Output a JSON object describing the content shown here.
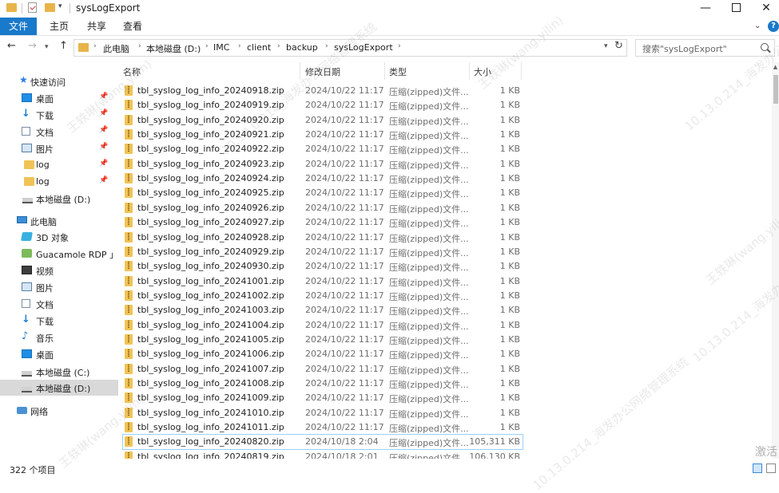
{
  "window": {
    "title": "sysLogExport",
    "min_glyph": "—",
    "close_glyph": "✕"
  },
  "ribbon": {
    "tabs": [
      {
        "label": "文件"
      },
      {
        "label": "主页"
      },
      {
        "label": "共享"
      },
      {
        "label": "查看"
      }
    ],
    "collapse_glyph": "⌄",
    "help_glyph": "?"
  },
  "address": {
    "crumbs": [
      "此电脑",
      "本地磁盘 (D:)",
      "IMC",
      "client",
      "backup",
      "sysLogExport"
    ],
    "separator": "›"
  },
  "search": {
    "placeholder": "搜索\"sysLogExport\""
  },
  "sidebar": {
    "items": [
      {
        "label": "快速访问",
        "icon": "star-icon",
        "pinned": false
      },
      {
        "label": "桌面",
        "icon": "desktop-icon",
        "pinned": true
      },
      {
        "label": "下载",
        "icon": "download-icon",
        "pinned": true
      },
      {
        "label": "文档",
        "icon": "document-icon",
        "pinned": true
      },
      {
        "label": "图片",
        "icon": "pictures-icon",
        "pinned": true
      },
      {
        "label": "log",
        "icon": "folder-icon",
        "pinned": true
      },
      {
        "label": "log",
        "icon": "folder-icon",
        "pinned": true
      },
      {
        "label": "本地磁盘 (D:)",
        "icon": "drive-icon",
        "pinned": false
      },
      {
        "label": "此电脑",
        "icon": "pc-icon",
        "pinned": false
      },
      {
        "label": "3D 对象",
        "icon": "3d-objects-icon",
        "pinned": false
      },
      {
        "label": "Guacamole RDP 」",
        "icon": "rdp-icon",
        "pinned": false
      },
      {
        "label": "视频",
        "icon": "video-icon",
        "pinned": false
      },
      {
        "label": "图片",
        "icon": "pictures-icon",
        "pinned": false
      },
      {
        "label": "文档",
        "icon": "document-icon",
        "pinned": false
      },
      {
        "label": "下载",
        "icon": "download-icon",
        "pinned": false
      },
      {
        "label": "音乐",
        "icon": "music-icon",
        "pinned": false
      },
      {
        "label": "桌面",
        "icon": "desktop-icon",
        "pinned": false
      },
      {
        "label": "本地磁盘 (C:)",
        "icon": "drive-icon",
        "pinned": false
      },
      {
        "label": "本地磁盘 (D:)",
        "icon": "drive-icon",
        "pinned": false,
        "selected": true
      },
      {
        "label": "网络",
        "icon": "network-icon",
        "pinned": false
      }
    ],
    "pin_glyph": "📌"
  },
  "columns": {
    "name": "名称",
    "date": "修改日期",
    "type": "类型",
    "size": "大小"
  },
  "files": [
    {
      "name": "tbl_syslog_log_info_20240918.zip",
      "date": "2024/10/22 11:17",
      "type": "压缩(zipped)文件...",
      "size": "1 KB"
    },
    {
      "name": "tbl_syslog_log_info_20240919.zip",
      "date": "2024/10/22 11:17",
      "type": "压缩(zipped)文件...",
      "size": "1 KB"
    },
    {
      "name": "tbl_syslog_log_info_20240920.zip",
      "date": "2024/10/22 11:17",
      "type": "压缩(zipped)文件...",
      "size": "1 KB"
    },
    {
      "name": "tbl_syslog_log_info_20240921.zip",
      "date": "2024/10/22 11:17",
      "type": "压缩(zipped)文件...",
      "size": "1 KB"
    },
    {
      "name": "tbl_syslog_log_info_20240922.zip",
      "date": "2024/10/22 11:17",
      "type": "压缩(zipped)文件...",
      "size": "1 KB"
    },
    {
      "name": "tbl_syslog_log_info_20240923.zip",
      "date": "2024/10/22 11:17",
      "type": "压缩(zipped)文件...",
      "size": "1 KB"
    },
    {
      "name": "tbl_syslog_log_info_20240924.zip",
      "date": "2024/10/22 11:17",
      "type": "压缩(zipped)文件...",
      "size": "1 KB"
    },
    {
      "name": "tbl_syslog_log_info_20240925.zip",
      "date": "2024/10/22 11:17",
      "type": "压缩(zipped)文件...",
      "size": "1 KB"
    },
    {
      "name": "tbl_syslog_log_info_20240926.zip",
      "date": "2024/10/22 11:17",
      "type": "压缩(zipped)文件...",
      "size": "1 KB"
    },
    {
      "name": "tbl_syslog_log_info_20240927.zip",
      "date": "2024/10/22 11:17",
      "type": "压缩(zipped)文件...",
      "size": "1 KB"
    },
    {
      "name": "tbl_syslog_log_info_20240928.zip",
      "date": "2024/10/22 11:17",
      "type": "压缩(zipped)文件...",
      "size": "1 KB"
    },
    {
      "name": "tbl_syslog_log_info_20240929.zip",
      "date": "2024/10/22 11:17",
      "type": "压缩(zipped)文件...",
      "size": "1 KB"
    },
    {
      "name": "tbl_syslog_log_info_20240930.zip",
      "date": "2024/10/22 11:17",
      "type": "压缩(zipped)文件...",
      "size": "1 KB"
    },
    {
      "name": "tbl_syslog_log_info_20241001.zip",
      "date": "2024/10/22 11:17",
      "type": "压缩(zipped)文件...",
      "size": "1 KB"
    },
    {
      "name": "tbl_syslog_log_info_20241002.zip",
      "date": "2024/10/22 11:17",
      "type": "压缩(zipped)文件...",
      "size": "1 KB"
    },
    {
      "name": "tbl_syslog_log_info_20241003.zip",
      "date": "2024/10/22 11:17",
      "type": "压缩(zipped)文件...",
      "size": "1 KB"
    },
    {
      "name": "tbl_syslog_log_info_20241004.zip",
      "date": "2024/10/22 11:17",
      "type": "压缩(zipped)文件...",
      "size": "1 KB"
    },
    {
      "name": "tbl_syslog_log_info_20241005.zip",
      "date": "2024/10/22 11:17",
      "type": "压缩(zipped)文件...",
      "size": "1 KB"
    },
    {
      "name": "tbl_syslog_log_info_20241006.zip",
      "date": "2024/10/22 11:17",
      "type": "压缩(zipped)文件...",
      "size": "1 KB"
    },
    {
      "name": "tbl_syslog_log_info_20241007.zip",
      "date": "2024/10/22 11:17",
      "type": "压缩(zipped)文件...",
      "size": "1 KB"
    },
    {
      "name": "tbl_syslog_log_info_20241008.zip",
      "date": "2024/10/22 11:17",
      "type": "压缩(zipped)文件...",
      "size": "1 KB"
    },
    {
      "name": "tbl_syslog_log_info_20241009.zip",
      "date": "2024/10/22 11:17",
      "type": "压缩(zipped)文件...",
      "size": "1 KB"
    },
    {
      "name": "tbl_syslog_log_info_20241010.zip",
      "date": "2024/10/22 11:17",
      "type": "压缩(zipped)文件...",
      "size": "1 KB"
    },
    {
      "name": "tbl_syslog_log_info_20241011.zip",
      "date": "2024/10/22 11:17",
      "type": "压缩(zipped)文件...",
      "size": "1 KB"
    },
    {
      "name": "tbl_syslog_log_info_20240820.zip",
      "date": "2024/10/18 2:04",
      "type": "压缩(zipped)文件...",
      "size": "105,311 KB",
      "selected": true
    },
    {
      "name": "tbl_syslog_log_info_20240819.zip",
      "date": "2024/10/18 2:01",
      "type": "压缩(zipped)文件...",
      "size": "106,130 KB"
    }
  ],
  "status": {
    "item_count": "322 个项目"
  },
  "overlay": {
    "activate_text": "激活"
  },
  "watermarks": [
    "王轶琳(wang.yilin)",
    "10.13.0.214_海发办公网络管理系统",
    "王轶琳(wang.yilin)",
    "10.13.0.214_海发办公网络管理系统",
    "王轶琳(wang.yilin)",
    "10.13.0.214_海发办公网络管理系统",
    "王轶琳(wang.yilin)",
    "10.13.0.214_海发办公网络管理系统"
  ],
  "colors": {
    "accent": "#1979ca",
    "selection_border": "#99d1ff",
    "folder": "#f0c356"
  }
}
